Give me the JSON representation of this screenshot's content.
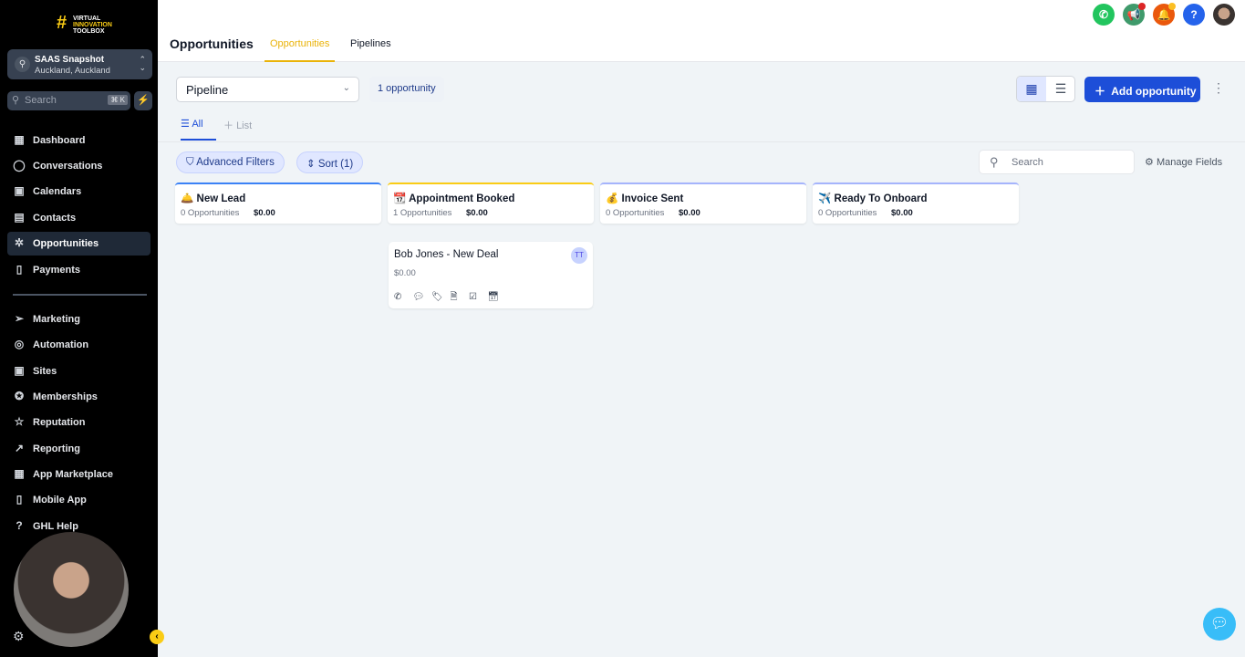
{
  "sidebar": {
    "logo": "VIRTUAL INNOVATION TOOLBOX",
    "account": {
      "name": "SAAS Snapshot",
      "location": "Auckland, Auckland"
    },
    "search": {
      "placeholder": "Search",
      "shortcut": "⌘ K"
    },
    "items": [
      {
        "label": "Dashboard",
        "icon": "grid-icon"
      },
      {
        "label": "Conversations",
        "icon": "chat-icon"
      },
      {
        "label": "Calendars",
        "icon": "calendar-icon"
      },
      {
        "label": "Contacts",
        "icon": "contacts-icon"
      },
      {
        "label": "Opportunities",
        "icon": "network-icon",
        "active": true
      },
      {
        "label": "Payments",
        "icon": "receipt-icon"
      },
      {
        "label": "Marketing",
        "icon": "send-icon"
      },
      {
        "label": "Automation",
        "icon": "automation-icon"
      },
      {
        "label": "Sites",
        "icon": "globe-icon"
      },
      {
        "label": "Memberships",
        "icon": "badge-icon"
      },
      {
        "label": "Reputation",
        "icon": "star-icon"
      },
      {
        "label": "Reporting",
        "icon": "trend-icon"
      },
      {
        "label": "App Marketplace",
        "icon": "grid-icon"
      },
      {
        "label": "Mobile App",
        "icon": "phone-icon"
      },
      {
        "label": "GHL Help",
        "icon": "help-icon"
      }
    ]
  },
  "header": {
    "title": "Opportunities",
    "tabs": [
      "Opportunities",
      "Pipelines"
    ],
    "active_tab": "Opportunities"
  },
  "toolbar": {
    "pipeline": "Pipeline",
    "count": "1 opportunity",
    "add_label": "Add opportunity"
  },
  "subtabs": {
    "all": "All",
    "list": "List"
  },
  "filters": {
    "advanced": "Advanced Filters",
    "sort": "Sort (1)",
    "search_placeholder": "Search",
    "manage": "Manage Fields"
  },
  "stages": [
    {
      "emoji": "🛎️",
      "name": "New Lead",
      "count": "0 Opportunities",
      "value": "$0.00",
      "color": "#3b82f6"
    },
    {
      "emoji": "📆",
      "name": "Appointment Booked",
      "count": "1 Opportunities",
      "value": "$0.00",
      "color": "#facc15"
    },
    {
      "emoji": "💰",
      "name": "Invoice Sent",
      "count": "0 Opportunities",
      "value": "$0.00",
      "color": "#a5b4fc"
    },
    {
      "emoji": "✈️",
      "name": "Ready To Onboard",
      "count": "0 Opportunities",
      "value": "$0.00",
      "color": "#a5b4fc"
    }
  ],
  "card": {
    "name": "Bob Jones - New Deal",
    "value": "$0.00",
    "avatar": "TT"
  }
}
